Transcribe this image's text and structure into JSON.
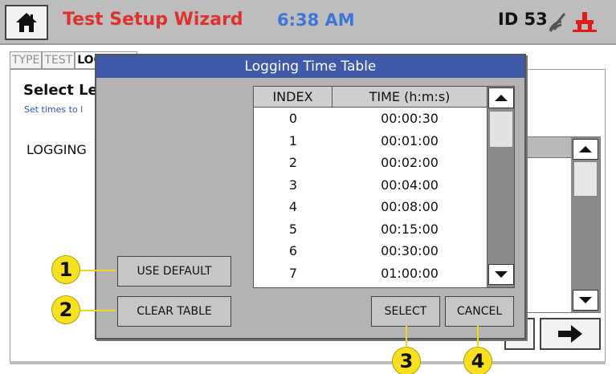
{
  "header": {
    "title": "Test Setup Wizard",
    "time": "6:38 AM",
    "device_id": "ID 53"
  },
  "tabs": [
    "TYPE",
    "TEST",
    "LOGGING",
    "",
    ""
  ],
  "page": {
    "heading": "Select Le",
    "subtext": "Set times to l",
    "logging_label": "LOGGING"
  },
  "dialog": {
    "title": "Logging Time Table",
    "columns": [
      "INDEX",
      "TIME (h:m:s)"
    ],
    "rows": [
      [
        "0",
        "00:00:30"
      ],
      [
        "1",
        "00:01:00"
      ],
      [
        "2",
        "00:02:00"
      ],
      [
        "3",
        "00:04:00"
      ],
      [
        "4",
        "00:08:00"
      ],
      [
        "5",
        "00:15:00"
      ],
      [
        "6",
        "00:30:00"
      ],
      [
        "7",
        "01:00:00"
      ]
    ],
    "buttons": {
      "use_default": "USE DEFAULT",
      "clear_table": "CLEAR TABLE",
      "select": "SELECT",
      "cancel": "CANCEL"
    }
  },
  "callouts": [
    "1",
    "2",
    "3",
    "4"
  ],
  "icons": {
    "home": "home-icon",
    "wifi": "wifi-off-icon",
    "connection": "connection-icon",
    "scroll_up": "up-arrow-icon",
    "scroll_down": "down-arrow-icon",
    "next": "right-arrow-icon"
  },
  "colors": {
    "title": "#e0312f",
    "time": "#3f74d8",
    "dialog_titlebar": "#3f5aa8",
    "callout": "#f6e020",
    "connection_icon": "#e21b1b"
  }
}
